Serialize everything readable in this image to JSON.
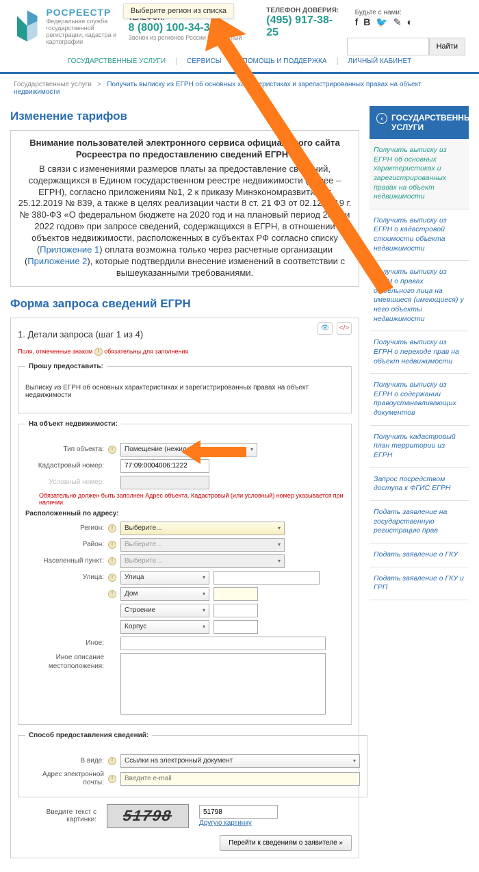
{
  "tooltip": "Выберите регион из списка",
  "header": {
    "logo_title": "РОСРЕЕСТР",
    "logo_sub": "Федеральная служба государственной регистрации, кадастра и картографии",
    "phone1_label": "ЕДИНЫЙ СПРАВОЧНЫЙ ТЕЛЕФОН:",
    "phone1_num": "8 (800) 100-34-34",
    "phone1_sub": "Звонок из регионов России бесплатный",
    "phone2_label": "ТЕЛЕФОН ДОВЕРИЯ:",
    "phone2_num": "(495) 917-38-25",
    "social_label": "Будьте с нами:",
    "search_btn": "Найти"
  },
  "nav": {
    "n0": "ГОСУДАРСТВЕННЫЕ УСЛУГИ",
    "n1": "СЕРВИСЫ",
    "n2": "ПОМОЩЬ И ПОДДЕРЖКА",
    "n3": "ЛИЧНЫЙ КАБИНЕТ"
  },
  "breadcrumb": {
    "b0": "Государственные услуги",
    "sep": ">",
    "b1": "Получить выписку из ЕГРН об основных характеристиках и зарегистрированных правах на объект недвижимости"
  },
  "tariff_heading": "Изменение тарифов",
  "notice": {
    "title": "Внимание пользователей электронного сервиса официального сайта Росреестра по предоставлению сведений ЕГРН !",
    "body1": "В связи с изменениями размеров платы за предоставление сведений, содержащихся в Едином государственном реестре недвижимости (далее – ЕГРН), согласно приложениям №1, 2 к приказу Минэкономразвития от 25.12.2019 № 839, а также в целях реализации части 8 ст. 21 ФЗ от 02.12.2019 г. № 380-ФЗ «О федеральном бюджете на 2020 год и на плановый период 2021 и 2022 годов» при запросе сведений, содержащихся в ЕГРН, в отношении объектов недвижимости, расположенных в субъектах РФ согласно списку (",
    "link1": "Приложение 1",
    "body2": ") оплата возможна только через расчетные организации (",
    "link2": "Приложение 2",
    "body3": "), которые подтвердили внесение изменений в соответствии с вышеуказанными требованиями."
  },
  "form_heading": "Форма запроса сведений ЕГРН",
  "step_title": "1. Детали запроса (шаг 1 из 4)",
  "req_note": "Поля, отмеченные знаком",
  "req_note2": "обязательны для заполнения",
  "fs": {
    "provide_legend": "Прошу предоставить:",
    "provide_text": "Выписку из ЕГРН об основных характеристиках и зарегистрированных правах на объект недвижимости",
    "object_legend": "На объект недвижимости:",
    "obj_type_label": "Тип объекта:",
    "obj_type_value": "Помещение (нежилое)",
    "cad_label": "Кадастровый номер:",
    "cad_value": "77:09:0004006:1222",
    "cond_label": "Условный номер:",
    "addr_note": "Обязательно должен быть заполнен Адрес объекта. Кадастровый (или условный) номер указывается при наличии.",
    "addr_legend": "Расположенный по адресу:",
    "region_label": "Регион:",
    "region_value": "Выберите...",
    "district_label": "Район:",
    "district_value": "Выберите...",
    "city_label": "Населенный пункт:",
    "city_value": "Выберите...",
    "street_label": "Улица:",
    "street_value": "Улица",
    "house": "Дом",
    "building": "Строение",
    "korpus": "Корпус",
    "other_label": "Иное:",
    "desc_label": "Иное описание местоположения:",
    "delivery_legend": "Способ предоставления сведений:",
    "format_label": "В виде:",
    "format_value": "Ссылки на электронный документ",
    "email_label": "Адрес электронной почты:",
    "email_ph": "Введите e-mail",
    "captcha_label": "Введите текст с картинки:",
    "captcha_text": "51798",
    "captcha_value": "51798",
    "captcha_link": "Другую картинку",
    "submit": "Перейти к сведениям о заявителе »"
  },
  "side": {
    "header": "ГОСУДАРСТВЕННЫЕ УСЛУГИ",
    "s0": "Получить выписку из ЕГРН об основных характеристиках и зарегистрированных правах на объект недвижимости",
    "s1": "Получить выписку из ЕГРН о кадастровой стоимости объекта недвижимости",
    "s2": "Получить выписку из ЕГРН о правах отдельного лица на имевшиеся (имеющиеся) у него объекты недвижимости",
    "s3": "Получить выписку из ЕГРН о переходе прав на объект недвижимости",
    "s4": "Получить выписку из ЕГРН о содержании правоустанавливающих документов",
    "s5": "Получить кадастровый план территории из ЕГРН",
    "s6": "Запрос посредством доступа к ФГИС ЕГРН",
    "s7": "Подать заявление на государственную регистрацию прав",
    "s8": "Подать заявление о ГКУ",
    "s9": "Подать заявление о ГКУ и ГРП"
  }
}
